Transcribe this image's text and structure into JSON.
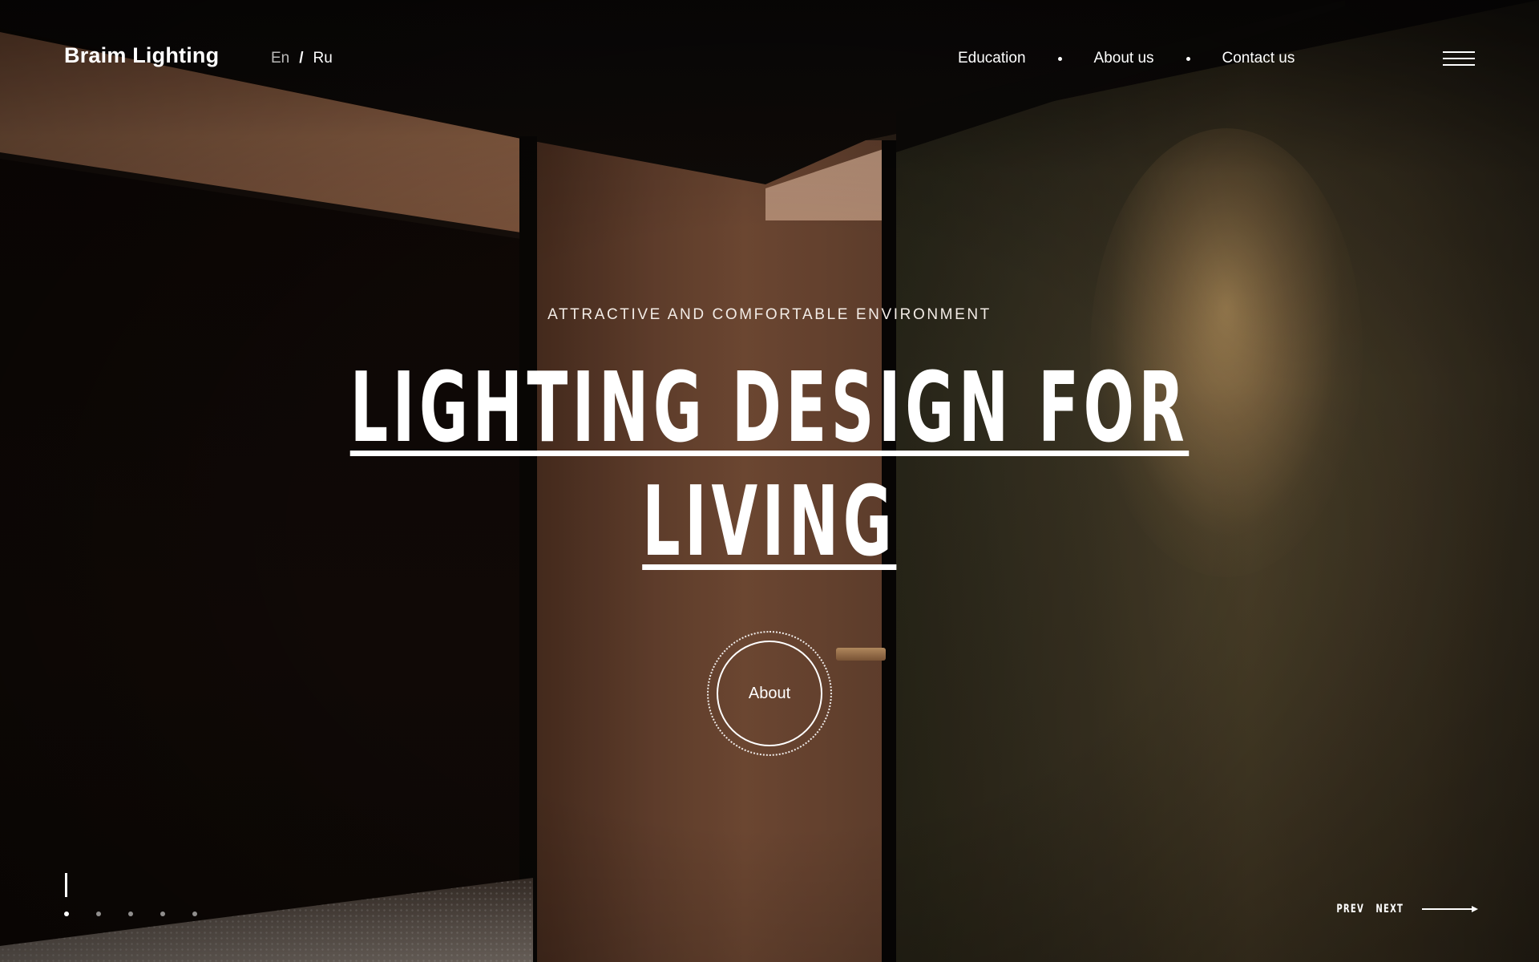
{
  "header": {
    "logo": "Braim Lighting",
    "languages": {
      "en": "En",
      "separator": "/",
      "ru": "Ru",
      "active": "Ru"
    },
    "nav": [
      {
        "label": "Education"
      },
      {
        "label": "About us"
      },
      {
        "label": "Contact us"
      }
    ],
    "menu_icon": "hamburger-menu-icon"
  },
  "hero": {
    "eyebrow": "ATTRACTIVE AND COMFORTABLE ENVIRONMENT",
    "title_line_1": "LIGHTING DESIGN FOR",
    "title_line_2": "LIVING",
    "cta_label": "About"
  },
  "slider": {
    "total_slides": 5,
    "active_index": 0,
    "prev_label": "PREV",
    "next_label": "NEXT",
    "arrow_icon": "arrow-right-icon"
  },
  "colors": {
    "text": "#ffffff",
    "muted_text": "#bdb6b0",
    "dark_bg": "#0b0806",
    "warm_wall": "#7a5038",
    "spotlight": "#cda569"
  }
}
